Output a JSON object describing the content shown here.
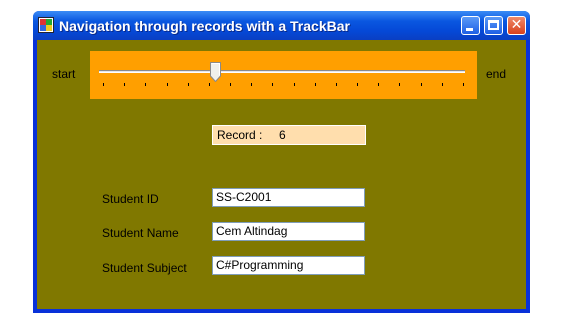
{
  "window": {
    "title": "Navigation through records  with a TrackBar",
    "icon": "app-form-icon"
  },
  "title_buttons": {
    "minimize": "minimize-icon",
    "maximize": "maximize-icon",
    "close_glyph": "✕"
  },
  "trackbar": {
    "start_label": "start",
    "end_label": "end",
    "ticks": 18,
    "value_fraction": 0.31
  },
  "record": {
    "label": "Record :",
    "value": "6"
  },
  "form": {
    "student_id_label": "Student ID",
    "student_id_value": "SS-C2001",
    "student_name_label": "Student Name",
    "student_name_value": "Cem Altindag",
    "student_subject_label": "Student Subject",
    "student_subject_value": "C#Programming"
  },
  "colors": {
    "client_background": "#807800",
    "trackbar_panel": "#ff9f00",
    "record_background": "#ffdead",
    "titlebar": "#0a57e0"
  }
}
